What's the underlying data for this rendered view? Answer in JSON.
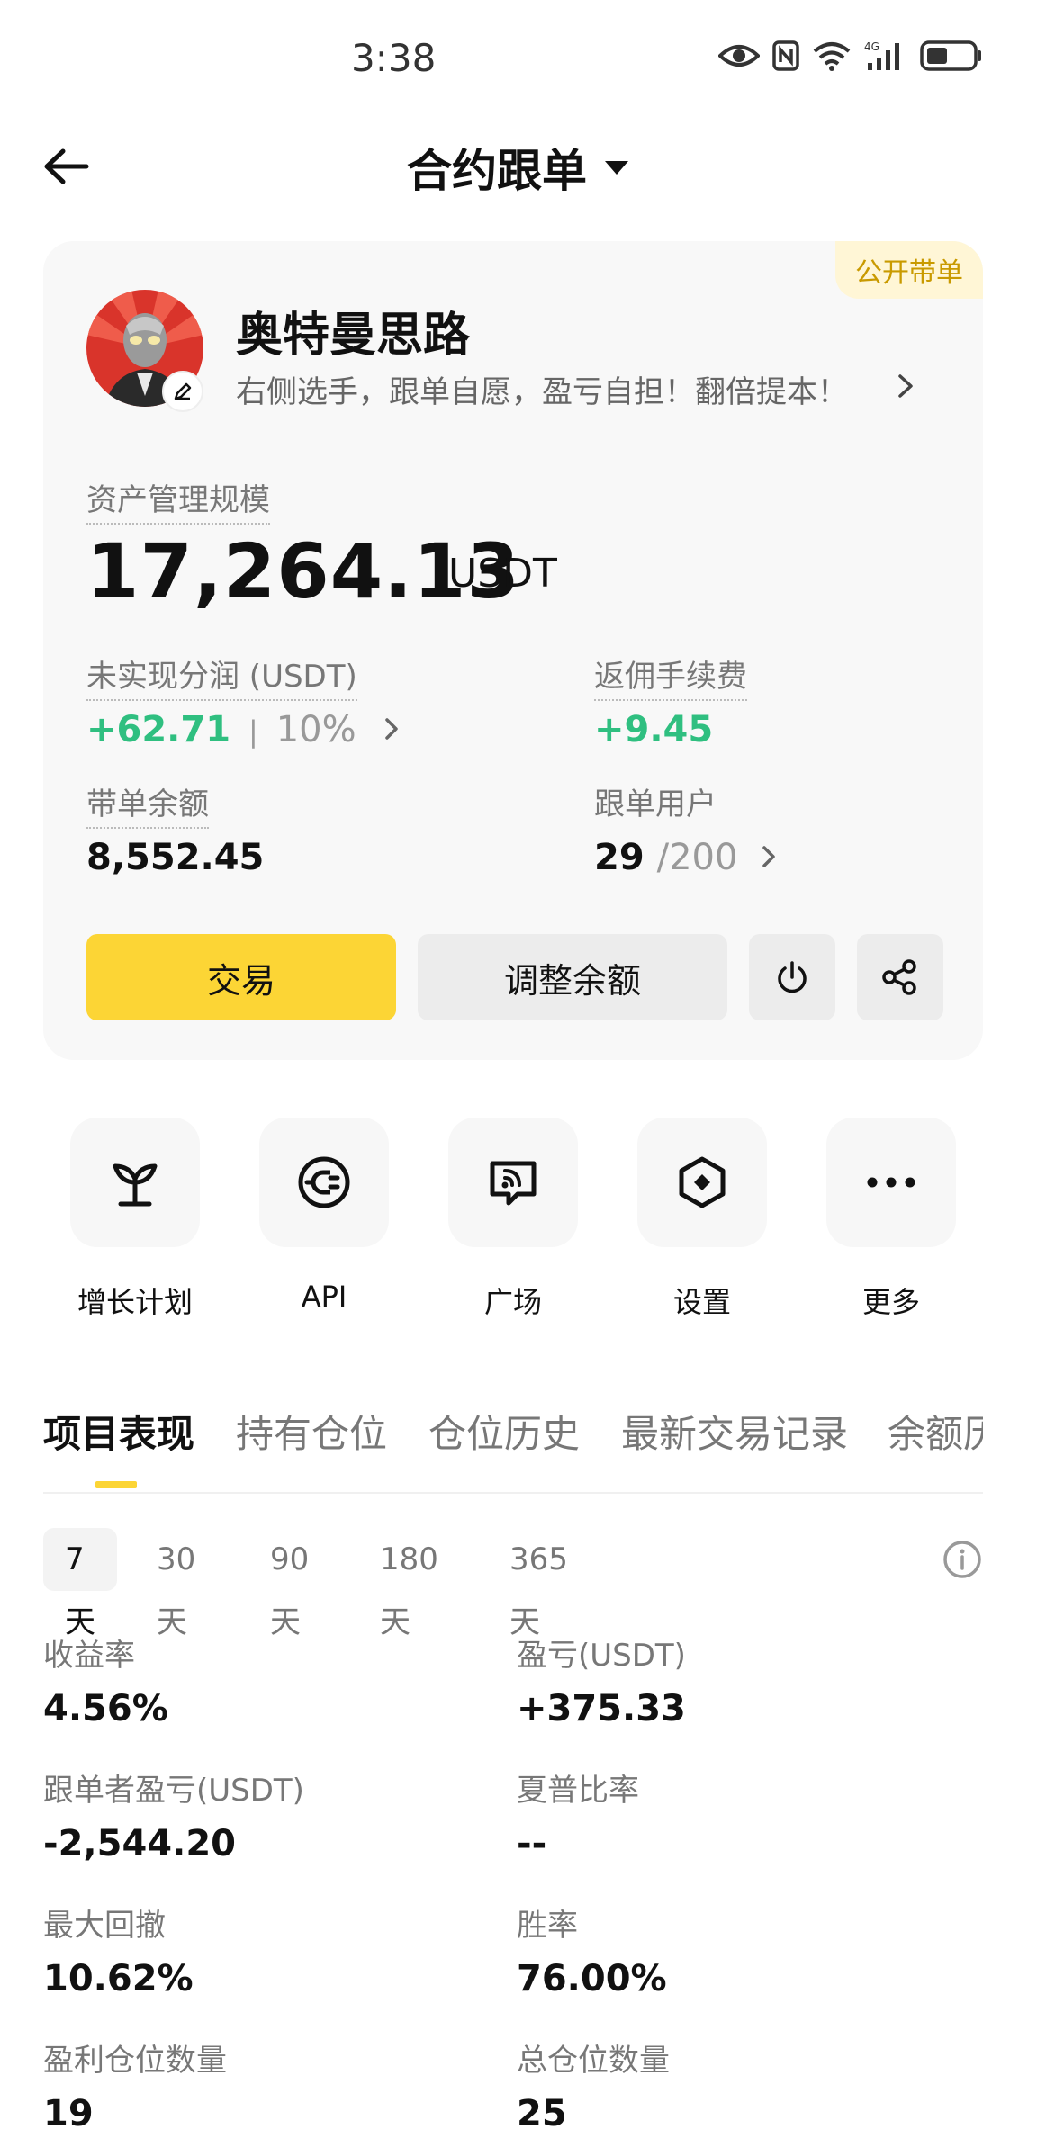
{
  "status_bar": {
    "time": "3:38",
    "icons": [
      "eye-icon",
      "nfc-icon",
      "wifi-icon",
      "signal-4g-icon",
      "battery-icon"
    ]
  },
  "header": {
    "title": "合约跟单",
    "back_icon": "arrow-left-icon",
    "dropdown_icon": "caret-down-icon"
  },
  "profile": {
    "badge": "公开带单",
    "nickname": "奥特曼思路",
    "bio": "右侧选手，跟单自愿，盈亏自担！翻倍提本！"
  },
  "aum": {
    "label": "资产管理规模",
    "value": "17,264.13",
    "unit": "USDT"
  },
  "stats": {
    "unrealized": {
      "label": "未实现分润 (USDT)",
      "value": "+62.71",
      "separator": "|",
      "percent": "10%"
    },
    "rebate": {
      "label": "返佣手续费",
      "value": "+9.45"
    },
    "balance": {
      "label": "带单余额",
      "value": "8,552.45"
    },
    "followers": {
      "label": "跟单用户",
      "count": "29",
      "max": "/200"
    }
  },
  "actions": {
    "trade": "交易",
    "adjust": "调整余额"
  },
  "quick_entries": [
    {
      "label": "增长计划",
      "icon": "sprout-icon"
    },
    {
      "label": "API",
      "icon": "plug-icon"
    },
    {
      "label": "广场",
      "icon": "broadcast-chat-icon"
    },
    {
      "label": "设置",
      "icon": "settings-hexagon-icon"
    },
    {
      "label": "更多",
      "icon": "more-dots-icon"
    }
  ],
  "tabs": [
    "项目表现",
    "持有仓位",
    "仓位历史",
    "最新交易记录",
    "余额历史"
  ],
  "periods": [
    "7天",
    "30天",
    "90天",
    "180天",
    "365天"
  ],
  "metrics": {
    "roi": {
      "label": "收益率",
      "value": "4.56%"
    },
    "pnl": {
      "label": "盈亏(USDT)",
      "value": "+375.33"
    },
    "follower_pnl": {
      "label": "跟单者盈亏(USDT)",
      "value": "-2,544.20"
    },
    "sharpe": {
      "label": "夏普比率",
      "value": "--"
    },
    "max_drawdown": {
      "label": "最大回撤",
      "value": "10.62%"
    },
    "win_rate": {
      "label": "胜率",
      "value": "76.00%"
    },
    "profit_positions": {
      "label": "盈利仓位数量",
      "value": "19"
    },
    "total_positions": {
      "label": "总仓位数量",
      "value": "25"
    }
  },
  "colors": {
    "accent": "#fcd535",
    "positive": "#2fbf80",
    "negative": "#e8455b"
  }
}
